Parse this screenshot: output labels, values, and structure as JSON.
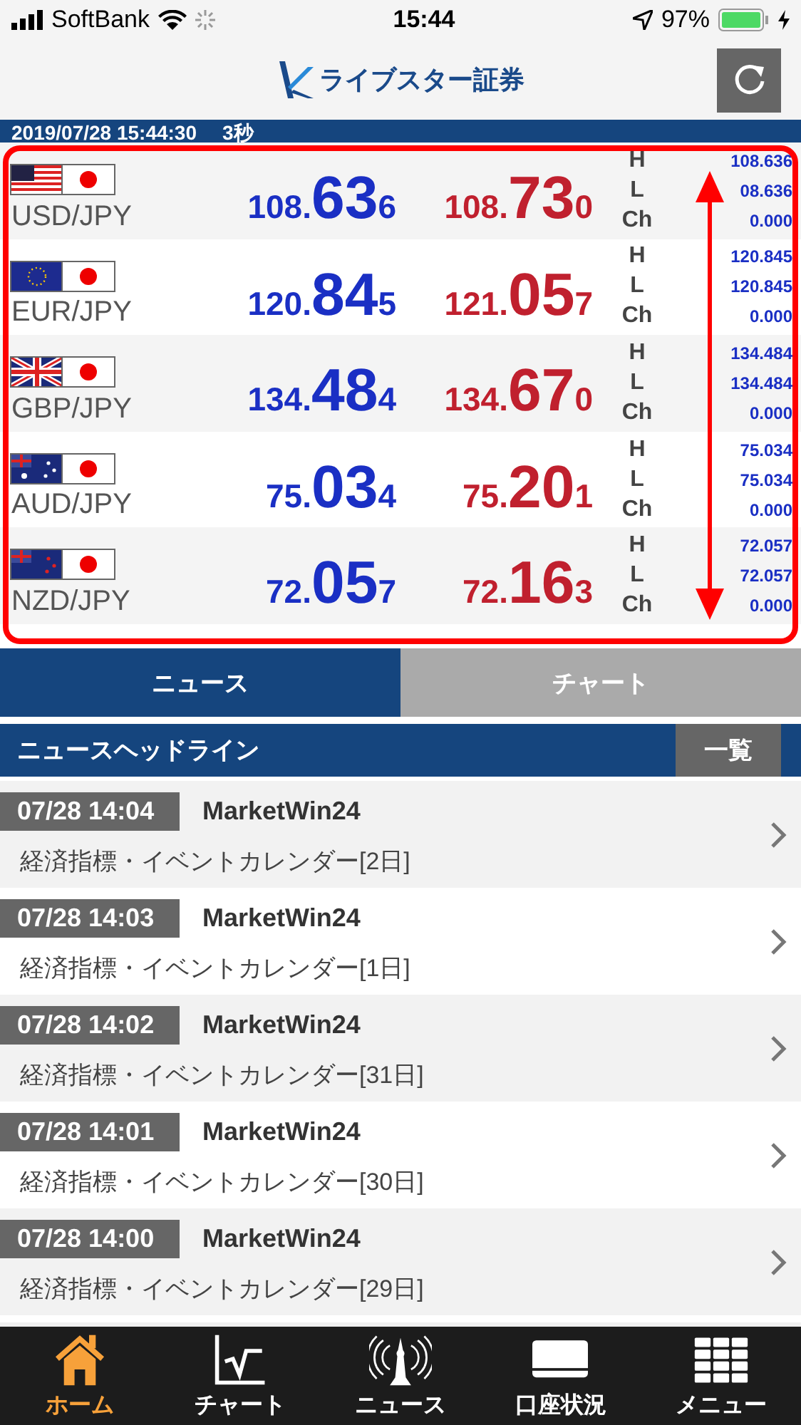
{
  "status_bar": {
    "carrier": "SoftBank",
    "time": "15:44",
    "battery": "97%"
  },
  "header": {
    "logo": "ライブスター証券"
  },
  "timestamp": {
    "datetime": "2019/07/28 15:44:30",
    "interval": "3秒"
  },
  "rates": [
    {
      "pair": "USD/JPY",
      "bid": {
        "head": "108.",
        "big": "63",
        "tail": "6"
      },
      "ask": {
        "head": "108.",
        "big": "73",
        "tail": "0"
      },
      "stats": [
        {
          "label": "H",
          "value": "108.636"
        },
        {
          "label": "L",
          "value": "08.636"
        },
        {
          "label": "Ch",
          "value": "0.000"
        }
      ]
    },
    {
      "pair": "EUR/JPY",
      "bid": {
        "head": "120.",
        "big": "84",
        "tail": "5"
      },
      "ask": {
        "head": "121.",
        "big": "05",
        "tail": "7"
      },
      "stats": [
        {
          "label": "H",
          "value": "120.845"
        },
        {
          "label": "L",
          "value": "120.845"
        },
        {
          "label": "Ch",
          "value": "0.000"
        }
      ]
    },
    {
      "pair": "GBP/JPY",
      "bid": {
        "head": "134.",
        "big": "48",
        "tail": "4"
      },
      "ask": {
        "head": "134.",
        "big": "67",
        "tail": "0"
      },
      "stats": [
        {
          "label": "H",
          "value": "134.484"
        },
        {
          "label": "L",
          "value": "134.484"
        },
        {
          "label": "Ch",
          "value": "0.000"
        }
      ]
    },
    {
      "pair": "AUD/JPY",
      "bid": {
        "head": "75.",
        "big": "03",
        "tail": "4"
      },
      "ask": {
        "head": "75.",
        "big": "20",
        "tail": "1"
      },
      "stats": [
        {
          "label": "H",
          "value": "75.034"
        },
        {
          "label": "L",
          "value": "75.034"
        },
        {
          "label": "Ch",
          "value": "0.000"
        }
      ]
    },
    {
      "pair": "NZD/JPY",
      "bid": {
        "head": "72.",
        "big": "05",
        "tail": "7"
      },
      "ask": {
        "head": "72.",
        "big": "16",
        "tail": "3"
      },
      "stats": [
        {
          "label": "H",
          "value": "72.057"
        },
        {
          "label": "L",
          "value": "72.057"
        },
        {
          "label": "Ch",
          "value": "0.000"
        }
      ]
    }
  ],
  "tabs": [
    {
      "label": "ニュース",
      "selected": true
    },
    {
      "label": "チャート",
      "selected": false
    }
  ],
  "news": {
    "title": "ニュースヘッドライン",
    "more_button": "一覧",
    "items": [
      {
        "time": "07/28 14:04",
        "source": "MarketWin24",
        "headline": "経済指標・イベントカレンダー[2日]"
      },
      {
        "time": "07/28 14:03",
        "source": "MarketWin24",
        "headline": "経済指標・イベントカレンダー[1日]"
      },
      {
        "time": "07/28 14:02",
        "source": "MarketWin24",
        "headline": "経済指標・イベントカレンダー[31日]"
      },
      {
        "time": "07/28 14:01",
        "source": "MarketWin24",
        "headline": "経済指標・イベントカレンダー[30日]"
      },
      {
        "time": "07/28 14:00",
        "source": "MarketWin24",
        "headline": "経済指標・イベントカレンダー[29日]"
      }
    ]
  },
  "nav": [
    {
      "kind": "home",
      "label": "ホーム",
      "selected": true
    },
    {
      "kind": "chart",
      "label": "チャート",
      "selected": false
    },
    {
      "kind": "news",
      "label": "ニュース",
      "selected": false
    },
    {
      "kind": "account",
      "label": "口座状況",
      "selected": false
    },
    {
      "kind": "menu",
      "label": "メニュー",
      "selected": false
    }
  ]
}
